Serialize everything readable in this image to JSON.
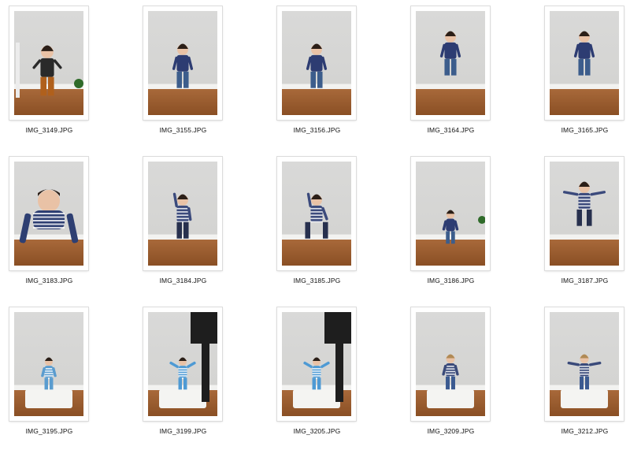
{
  "browser": {
    "files": [
      {
        "name": "IMG_3149.JPG",
        "pose": "standing-adult",
        "shirt": "#2a2a2a",
        "pants": "#b0601c"
      },
      {
        "name": "IMG_3155.JPG",
        "pose": "standing",
        "shirt": "#2d3c72",
        "pants": "#3c5d8c"
      },
      {
        "name": "IMG_3156.JPG",
        "pose": "standing",
        "shirt": "#2d3c72",
        "pants": "#3c5d8c"
      },
      {
        "name": "IMG_3164.JPG",
        "pose": "jumping",
        "shirt": "#2d3c72",
        "pants": "#3c5d8c"
      },
      {
        "name": "IMG_3165.JPG",
        "pose": "jumping",
        "shirt": "#2d3c72",
        "pants": "#3c5d8c"
      },
      {
        "name": "IMG_3183.JPG",
        "pose": "crawling",
        "shirt": "#2e3f72",
        "pants": "#2b3a60"
      },
      {
        "name": "IMG_3184.JPG",
        "pose": "arm-up",
        "shirt": "#3b4a7c",
        "pants": "#27304e"
      },
      {
        "name": "IMG_3185.JPG",
        "pose": "star",
        "shirt": "#3b4a7c",
        "pants": "#27304e"
      },
      {
        "name": "IMG_3186.JPG",
        "pose": "standing-small",
        "shirt": "#2d3c72",
        "pants": "#3c5d8c"
      },
      {
        "name": "IMG_3187.JPG",
        "pose": "jumping-wide",
        "shirt": "#3b4a7c",
        "pants": "#27304e"
      },
      {
        "name": "IMG_3195.JPG",
        "pose": "baby-sitting",
        "shirt": "#5a9ccf",
        "pants": "#5a9ccf"
      },
      {
        "name": "IMG_3199.JPG",
        "pose": "baby-held",
        "shirt": "#4e9ad4",
        "pants": "#4e9ad4"
      },
      {
        "name": "IMG_3205.JPG",
        "pose": "baby-held",
        "shirt": "#4e9ad4",
        "pants": "#4e9ad4"
      },
      {
        "name": "IMG_3209.JPG",
        "pose": "toddler",
        "shirt": "#3a4a7a",
        "pants": "#3b5a90"
      },
      {
        "name": "IMG_3212.JPG",
        "pose": "toddler-arms",
        "shirt": "#3a4a7a",
        "pants": "#3b5a90"
      }
    ]
  },
  "colors": {
    "wall": "#d6d6d4",
    "floor": "#8c5225",
    "baseboard": "#f2f2f0",
    "white_box": "#f4f4f2",
    "skin": "#e9c2a6",
    "hair_dark": "#2b1f18",
    "hair_blond": "#b08a55"
  }
}
